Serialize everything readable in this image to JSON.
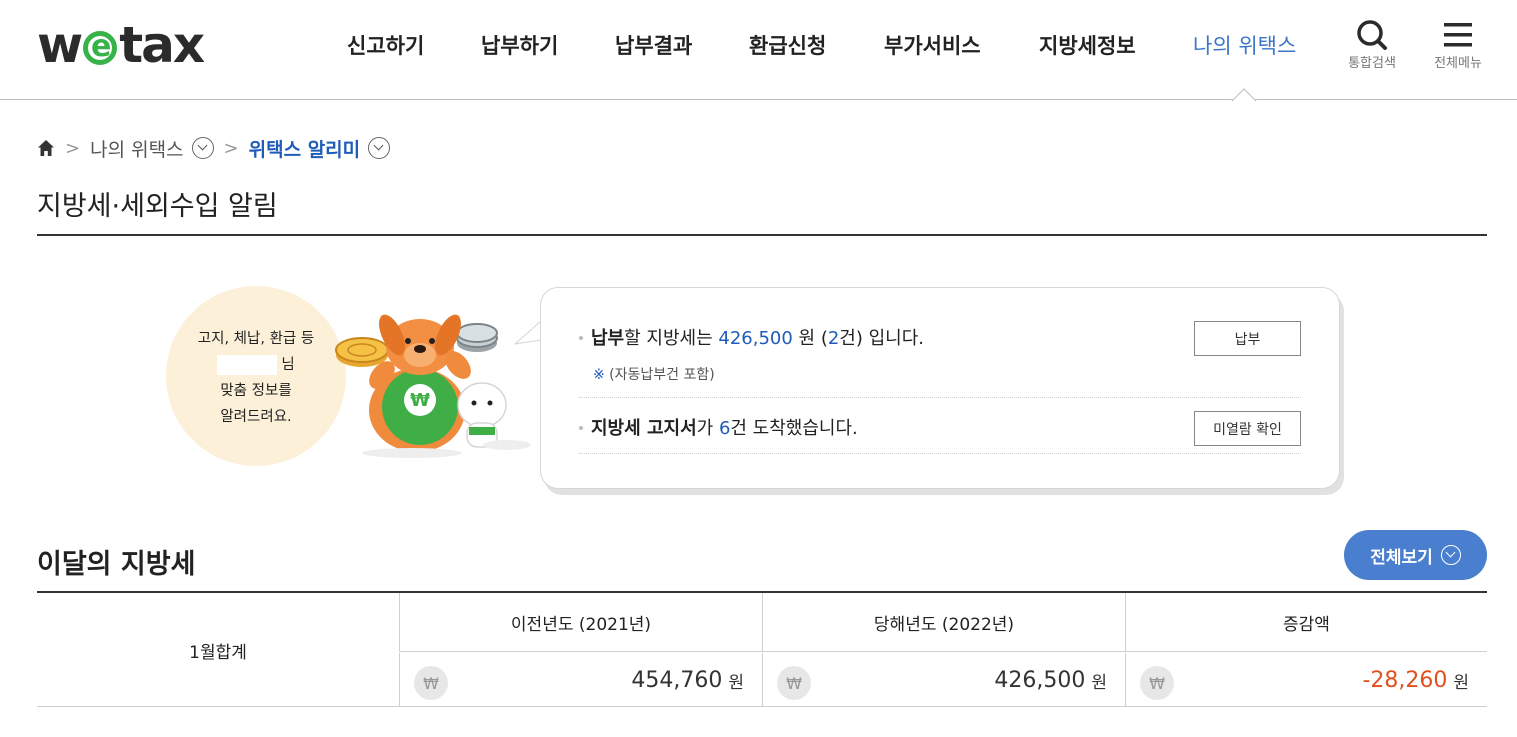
{
  "header": {
    "logo_pre": "w",
    "logo_e": "e",
    "logo_post": "tax",
    "nav": [
      "신고하기",
      "납부하기",
      "납부결과",
      "환급신청",
      "부가서비스",
      "지방세정보",
      "나의 위택스"
    ],
    "search_label": "통합검색",
    "menu_label": "전체메뉴"
  },
  "breadcrumb": {
    "level1": "나의 위택스",
    "current": "위택스 알리미"
  },
  "page_title": "지방세·세외수입 알림",
  "notice": {
    "greeting_line1": "고지, 체납, 환급 등",
    "greeting_suffix": "님",
    "greeting_line3": "맞춤 정보를",
    "greeting_line4": "알려드려요.",
    "row1_bold": "납부",
    "row1_text1": "할 지방세는 ",
    "row1_amount": "426,500",
    "row1_text2": " 원 (",
    "row1_count": "2",
    "row1_text3": "건) 입니다.",
    "note_mark": "※",
    "note_text": " (자동납부건 포함)",
    "pay_button": "납부",
    "row2_bold": "지방세 고지서",
    "row2_text1": "가 ",
    "row2_count": "6",
    "row2_text2": "건 도착했습니다.",
    "unread_button": "미열람 확인"
  },
  "section": {
    "title": "이달의 지방세",
    "view_all": "전체보기"
  },
  "table": {
    "row_label": "1월합계",
    "headers": [
      "이전년도 (2021년)",
      "당해년도 (2022년)",
      "증감액"
    ],
    "values": [
      "454,760",
      "426,500",
      "-28,260"
    ],
    "currency_symbol": "₩",
    "unit": "원"
  },
  "colors": {
    "accent_blue": "#1f5cb8",
    "button_blue": "#4a7fd0",
    "negative": "#e2511d",
    "logo_green": "#37b34a"
  }
}
